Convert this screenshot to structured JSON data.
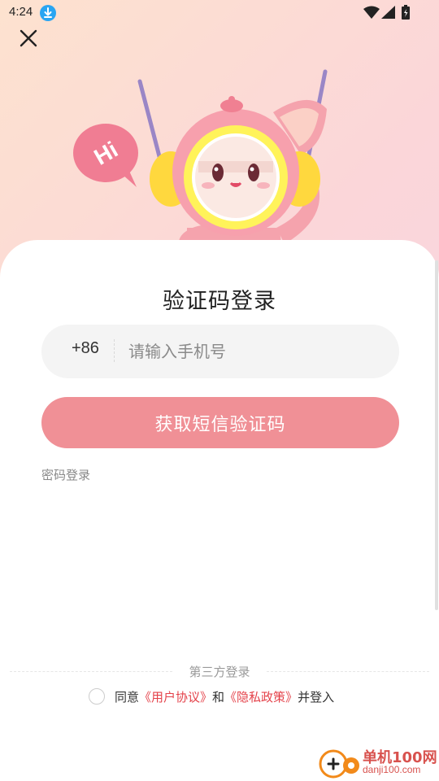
{
  "status_bar": {
    "time": "4:24",
    "icons": [
      "download-icon",
      "wifi-icon",
      "signal-icon",
      "battery-icon"
    ]
  },
  "header": {
    "close_icon": "close-icon"
  },
  "mascot": {
    "bubble_text": "Hi"
  },
  "login": {
    "title": "验证码登录",
    "country_code": "+86",
    "phone_placeholder": "请输入手机号",
    "sms_button_label": "获取短信验证码",
    "password_login_link": "密码登录"
  },
  "footer": {
    "third_party_label": "第三方登录",
    "agree_prefix": "同意",
    "user_agreement": "《用户协议》",
    "and": "和",
    "privacy_policy": "《隐私政策》",
    "agree_suffix": "并登入"
  },
  "watermark": {
    "name": "单机100网",
    "url": "danji100.com"
  },
  "colors": {
    "accent": "#f09096",
    "link": "#e4424a",
    "background_top": "#fde2cf"
  }
}
